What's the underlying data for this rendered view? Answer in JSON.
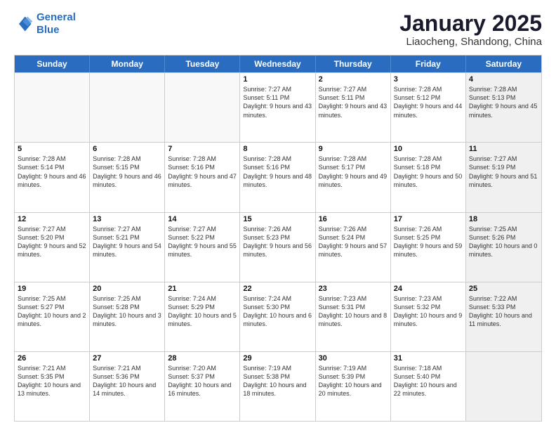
{
  "logo": {
    "line1": "General",
    "line2": "Blue"
  },
  "title": "January 2025",
  "subtitle": "Liaocheng, Shandong, China",
  "headers": [
    "Sunday",
    "Monday",
    "Tuesday",
    "Wednesday",
    "Thursday",
    "Friday",
    "Saturday"
  ],
  "weeks": [
    [
      {
        "day": "",
        "text": "",
        "empty": true
      },
      {
        "day": "",
        "text": "",
        "empty": true
      },
      {
        "day": "",
        "text": "",
        "empty": true
      },
      {
        "day": "1",
        "text": "Sunrise: 7:27 AM\nSunset: 5:11 PM\nDaylight: 9 hours\nand 43 minutes.",
        "empty": false
      },
      {
        "day": "2",
        "text": "Sunrise: 7:27 AM\nSunset: 5:11 PM\nDaylight: 9 hours\nand 43 minutes.",
        "empty": false
      },
      {
        "day": "3",
        "text": "Sunrise: 7:28 AM\nSunset: 5:12 PM\nDaylight: 9 hours\nand 44 minutes.",
        "empty": false
      },
      {
        "day": "4",
        "text": "Sunrise: 7:28 AM\nSunset: 5:13 PM\nDaylight: 9 hours\nand 45 minutes.",
        "empty": false,
        "shaded": true
      }
    ],
    [
      {
        "day": "5",
        "text": "Sunrise: 7:28 AM\nSunset: 5:14 PM\nDaylight: 9 hours\nand 46 minutes.",
        "empty": false
      },
      {
        "day": "6",
        "text": "Sunrise: 7:28 AM\nSunset: 5:15 PM\nDaylight: 9 hours\nand 46 minutes.",
        "empty": false
      },
      {
        "day": "7",
        "text": "Sunrise: 7:28 AM\nSunset: 5:16 PM\nDaylight: 9 hours\nand 47 minutes.",
        "empty": false
      },
      {
        "day": "8",
        "text": "Sunrise: 7:28 AM\nSunset: 5:16 PM\nDaylight: 9 hours\nand 48 minutes.",
        "empty": false
      },
      {
        "day": "9",
        "text": "Sunrise: 7:28 AM\nSunset: 5:17 PM\nDaylight: 9 hours\nand 49 minutes.",
        "empty": false
      },
      {
        "day": "10",
        "text": "Sunrise: 7:28 AM\nSunset: 5:18 PM\nDaylight: 9 hours\nand 50 minutes.",
        "empty": false
      },
      {
        "day": "11",
        "text": "Sunrise: 7:27 AM\nSunset: 5:19 PM\nDaylight: 9 hours\nand 51 minutes.",
        "empty": false,
        "shaded": true
      }
    ],
    [
      {
        "day": "12",
        "text": "Sunrise: 7:27 AM\nSunset: 5:20 PM\nDaylight: 9 hours\nand 52 minutes.",
        "empty": false
      },
      {
        "day": "13",
        "text": "Sunrise: 7:27 AM\nSunset: 5:21 PM\nDaylight: 9 hours\nand 54 minutes.",
        "empty": false
      },
      {
        "day": "14",
        "text": "Sunrise: 7:27 AM\nSunset: 5:22 PM\nDaylight: 9 hours\nand 55 minutes.",
        "empty": false
      },
      {
        "day": "15",
        "text": "Sunrise: 7:26 AM\nSunset: 5:23 PM\nDaylight: 9 hours\nand 56 minutes.",
        "empty": false
      },
      {
        "day": "16",
        "text": "Sunrise: 7:26 AM\nSunset: 5:24 PM\nDaylight: 9 hours\nand 57 minutes.",
        "empty": false
      },
      {
        "day": "17",
        "text": "Sunrise: 7:26 AM\nSunset: 5:25 PM\nDaylight: 9 hours\nand 59 minutes.",
        "empty": false
      },
      {
        "day": "18",
        "text": "Sunrise: 7:25 AM\nSunset: 5:26 PM\nDaylight: 10 hours\nand 0 minutes.",
        "empty": false,
        "shaded": true
      }
    ],
    [
      {
        "day": "19",
        "text": "Sunrise: 7:25 AM\nSunset: 5:27 PM\nDaylight: 10 hours\nand 2 minutes.",
        "empty": false
      },
      {
        "day": "20",
        "text": "Sunrise: 7:25 AM\nSunset: 5:28 PM\nDaylight: 10 hours\nand 3 minutes.",
        "empty": false
      },
      {
        "day": "21",
        "text": "Sunrise: 7:24 AM\nSunset: 5:29 PM\nDaylight: 10 hours\nand 5 minutes.",
        "empty": false
      },
      {
        "day": "22",
        "text": "Sunrise: 7:24 AM\nSunset: 5:30 PM\nDaylight: 10 hours\nand 6 minutes.",
        "empty": false
      },
      {
        "day": "23",
        "text": "Sunrise: 7:23 AM\nSunset: 5:31 PM\nDaylight: 10 hours\nand 8 minutes.",
        "empty": false
      },
      {
        "day": "24",
        "text": "Sunrise: 7:23 AM\nSunset: 5:32 PM\nDaylight: 10 hours\nand 9 minutes.",
        "empty": false
      },
      {
        "day": "25",
        "text": "Sunrise: 7:22 AM\nSunset: 5:33 PM\nDaylight: 10 hours\nand 11 minutes.",
        "empty": false,
        "shaded": true
      }
    ],
    [
      {
        "day": "26",
        "text": "Sunrise: 7:21 AM\nSunset: 5:35 PM\nDaylight: 10 hours\nand 13 minutes.",
        "empty": false
      },
      {
        "day": "27",
        "text": "Sunrise: 7:21 AM\nSunset: 5:36 PM\nDaylight: 10 hours\nand 14 minutes.",
        "empty": false
      },
      {
        "day": "28",
        "text": "Sunrise: 7:20 AM\nSunset: 5:37 PM\nDaylight: 10 hours\nand 16 minutes.",
        "empty": false
      },
      {
        "day": "29",
        "text": "Sunrise: 7:19 AM\nSunset: 5:38 PM\nDaylight: 10 hours\nand 18 minutes.",
        "empty": false
      },
      {
        "day": "30",
        "text": "Sunrise: 7:19 AM\nSunset: 5:39 PM\nDaylight: 10 hours\nand 20 minutes.",
        "empty": false
      },
      {
        "day": "31",
        "text": "Sunrise: 7:18 AM\nSunset: 5:40 PM\nDaylight: 10 hours\nand 22 minutes.",
        "empty": false
      },
      {
        "day": "",
        "text": "",
        "empty": true,
        "shaded": true
      }
    ]
  ]
}
